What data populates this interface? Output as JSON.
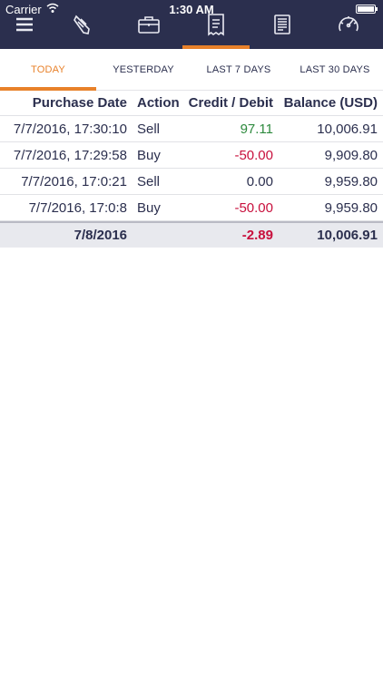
{
  "status_bar": {
    "carrier": "Carrier",
    "time": "1:30 AM"
  },
  "nav": {
    "icons": [
      "menu-icon",
      "pencil-icon",
      "briefcase-icon",
      "receipt-icon",
      "report-icon",
      "speedometer-icon"
    ],
    "active": "receipt-icon",
    "accent_color": "#e8812a",
    "bar_color": "#2b2f4e"
  },
  "tabs": [
    {
      "label": "TODAY",
      "active": true
    },
    {
      "label": "YESTERDAY",
      "active": false
    },
    {
      "label": "LAST 7 DAYS",
      "active": false
    },
    {
      "label": "LAST 30 DAYS",
      "active": false
    }
  ],
  "table": {
    "headers": {
      "purchase_date": "Purchase Date",
      "action": "Action",
      "credit_debit": "Credit / Debit",
      "balance": "Balance (USD)"
    },
    "rows": [
      {
        "purchase_date": "7/7/2016, 17:30:10",
        "action": "Sell",
        "credit_debit": "97.11",
        "balance": "10,006.91",
        "credit_color": "#2e8a3e"
      },
      {
        "purchase_date": "7/7/2016, 17:29:58",
        "action": "Buy",
        "credit_debit": "-50.00",
        "balance": "9,909.80",
        "credit_color": "#c8103d"
      },
      {
        "purchase_date": "7/7/2016, 17:0:21",
        "action": "Sell",
        "credit_debit": "0.00",
        "balance": "9,959.80",
        "credit_color": "#2b2f4e"
      },
      {
        "purchase_date": "7/7/2016, 17:0:8",
        "action": "Buy",
        "credit_debit": "-50.00",
        "balance": "9,959.80",
        "credit_color": "#c8103d"
      }
    ],
    "total": {
      "date": "7/8/2016",
      "credit_debit": "-2.89",
      "balance": "10,006.91",
      "credit_color": "#c8103d"
    }
  }
}
